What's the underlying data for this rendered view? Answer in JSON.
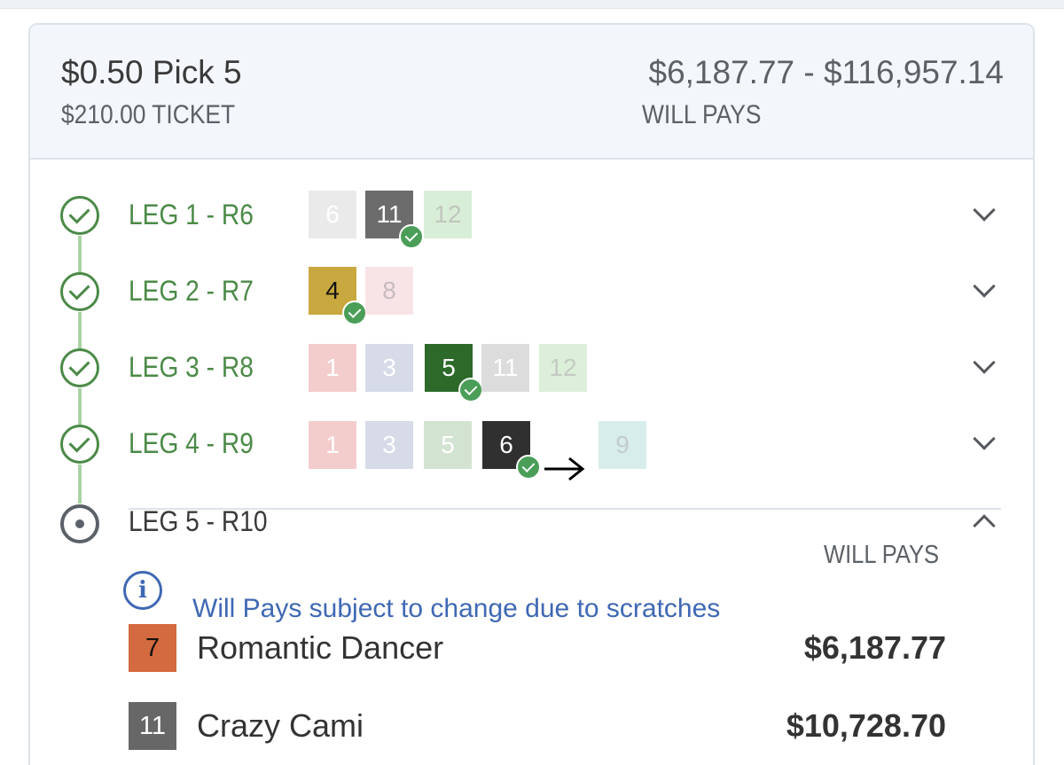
{
  "header": {
    "title": "$0.50 Pick 5",
    "ticket": "$210.00 TICKET",
    "pay_range": "$6,187.77 - $116,957.14",
    "will_pays": "WILL PAYS"
  },
  "legs": [
    {
      "label": "LEG 1 - R6",
      "status": "complete",
      "horses": [
        {
          "num": "6",
          "bg": "#c9c9c9",
          "fg": "#ffffff",
          "selected": false
        },
        {
          "num": "11",
          "bg": "#6c6c6c",
          "fg": "#ffffff",
          "selected": true
        },
        {
          "num": "12",
          "bg": "#d9eed7",
          "fg": "#c0c6bf",
          "selected": false
        }
      ]
    },
    {
      "label": "LEG 2 - R7",
      "status": "complete",
      "horses": [
        {
          "num": "4",
          "bg": "#c8a83f",
          "fg": "#111111",
          "selected": true
        },
        {
          "num": "8",
          "bg": "#f8e3e6",
          "fg": "#c7bcbe",
          "selected": false
        }
      ]
    },
    {
      "label": "LEG 3 - R8",
      "status": "complete",
      "horses": [
        {
          "num": "1",
          "bg": "#f3cccc",
          "fg": "#ffffff",
          "selected": false
        },
        {
          "num": "3",
          "bg": "#d6dbe7",
          "fg": "#ffffff",
          "selected": false
        },
        {
          "num": "5",
          "bg": "#2d6a2a",
          "fg": "#ffffff",
          "selected": true
        },
        {
          "num": "11",
          "bg": "#dcdcdc",
          "fg": "#ffffff",
          "selected": false
        },
        {
          "num": "12",
          "bg": "#dcefd9",
          "fg": "#c4cbc3",
          "selected": false
        }
      ]
    },
    {
      "label": "LEG 4 - R9",
      "status": "complete",
      "horses": [
        {
          "num": "1",
          "bg": "#f3cccc",
          "fg": "#ffffff",
          "selected": false
        },
        {
          "num": "3",
          "bg": "#d6dbe7",
          "fg": "#ffffff",
          "selected": false
        },
        {
          "num": "5",
          "bg": "#d3e3d2",
          "fg": "#ffffff",
          "selected": false
        },
        {
          "num": "6",
          "bg": "#303030",
          "fg": "#ffffff",
          "selected": true
        },
        {
          "num": "9",
          "bg": "#d7edeb",
          "fg": "#c1cccb",
          "selected": false
        }
      ]
    },
    {
      "label": "LEG 5 - R10",
      "status": "current",
      "horses": []
    }
  ],
  "leg5": {
    "will_pays_label": "WILL PAYS",
    "info_text": "Will Pays subject to change due to scratches",
    "runners": [
      {
        "num": "7",
        "bg": "#d46a3f",
        "fg": "#111111",
        "name": "Romantic Dancer",
        "pay": "$6,187.77"
      },
      {
        "num": "11",
        "bg": "#676767",
        "fg": "#ffffff",
        "name": "Crazy Cami",
        "pay": "$10,728.70"
      }
    ]
  },
  "icons": {
    "complete": "check-circle-icon",
    "current": "radio-dot-icon",
    "expand": "chevron-down-icon",
    "collapse": "chevron-up-icon",
    "info": "info-icon",
    "swap": "arrow-right-icon"
  },
  "colors": {
    "complete_green": "#4b8a47",
    "connector_green": "#a9d3a5",
    "info_blue": "#3f68b4",
    "winner_check": "#4a9e58"
  }
}
